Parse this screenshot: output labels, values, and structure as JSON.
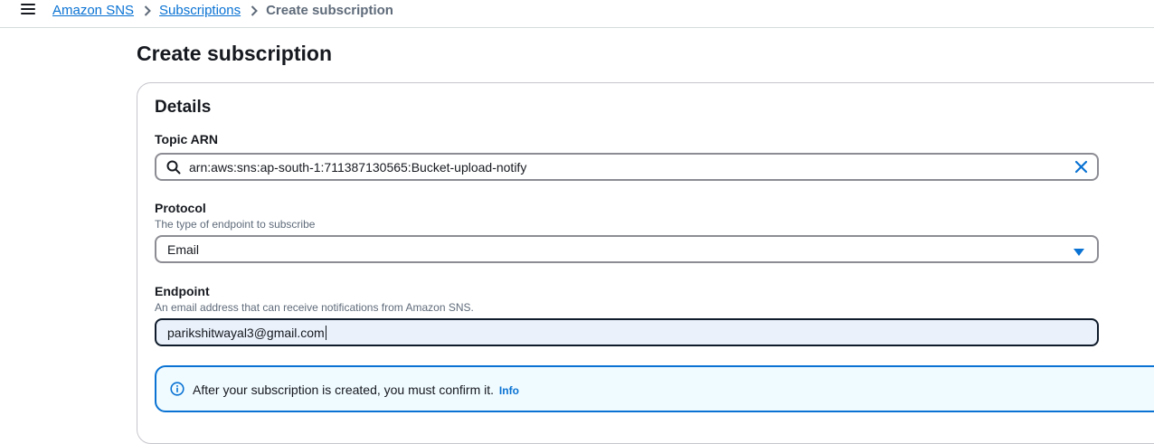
{
  "breadcrumb": {
    "items": [
      "Amazon SNS",
      "Subscriptions"
    ],
    "current": "Create subscription"
  },
  "page": {
    "title": "Create subscription"
  },
  "details": {
    "title": "Details",
    "topic_arn": {
      "label": "Topic ARN",
      "value": "arn:aws:sns:ap-south-1:711387130565:Bucket-upload-notify"
    },
    "protocol": {
      "label": "Protocol",
      "description": "The type of endpoint to subscribe",
      "value": "Email"
    },
    "endpoint": {
      "label": "Endpoint",
      "description": "An email address that can receive notifications from Amazon SNS.",
      "value": "parikshitwayal3@gmail.com"
    },
    "alert": {
      "text": "After your subscription is created, you must confirm it.",
      "link": "Info"
    }
  },
  "colors": {
    "link": "#0972d3",
    "text": "#16191f",
    "muted": "#5f6b7a",
    "alert_bg": "#f0fbff",
    "focused_bg": "#eaf1fb"
  },
  "icons": [
    "menu-icon",
    "chevron-right-icon",
    "search-icon",
    "clear-icon",
    "caret-down-icon",
    "info-icon"
  ]
}
